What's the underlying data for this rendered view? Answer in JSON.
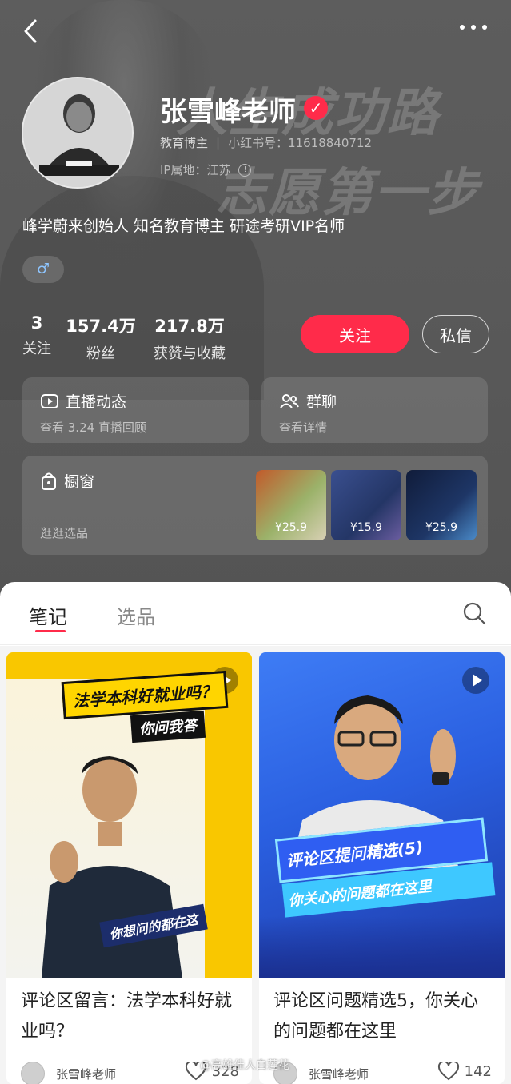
{
  "profile": {
    "name": "张雪峰老师",
    "role": "教育博主",
    "id_label": "小红书号：11618840712",
    "ip_label": "IP属地：江苏",
    "bio": "峰学蔚来创始人 知名教育博主 研途考研VIP名师",
    "gender_symbol": "♂"
  },
  "background_text": {
    "line1": "人生成功路",
    "line2": "志愿第一步"
  },
  "stats": [
    {
      "value": "3",
      "label": "关注"
    },
    {
      "value": "157.4万",
      "label": "粉丝"
    },
    {
      "value": "217.8万",
      "label": "获赞与收藏"
    }
  ],
  "actions": {
    "follow": "关注",
    "message": "私信"
  },
  "cards": {
    "live": {
      "title": "直播动态",
      "sub": "查看 3.24 直播回顾"
    },
    "group": {
      "title": "群聊",
      "sub": "查看详情"
    },
    "shop": {
      "title": "橱窗",
      "sub": "逛逛选品"
    }
  },
  "shop_items": [
    {
      "price": "¥25.9",
      "bg": "#8a6a3a"
    },
    {
      "price": "¥15.9",
      "bg": "#2c3e7a"
    },
    {
      "price": "¥25.9",
      "bg": "#1c2e55"
    }
  ],
  "tabs": [
    {
      "label": "笔记",
      "active": true
    },
    {
      "label": "选品",
      "active": false
    }
  ],
  "notes": [
    {
      "cover_heading": "法学本科好就业吗？",
      "cover_sub": "你问我答",
      "cover_tag": "你想问的都在这",
      "title": "评论区留言：法学本科好就业吗？",
      "author": "张雪峰老师",
      "likes": "328"
    },
    {
      "cover_heading": "评论区提问精选(5)",
      "cover_sub": "你关心的问题都在这里",
      "title": "评论区问题精选5，你关心的问题都在这里",
      "author": "张雪峰老师",
      "likes": "142"
    }
  ],
  "watermark": "@高雄佳人白莲花",
  "colors": {
    "accent": "#ff2b4a",
    "header_bg": "#595959"
  }
}
